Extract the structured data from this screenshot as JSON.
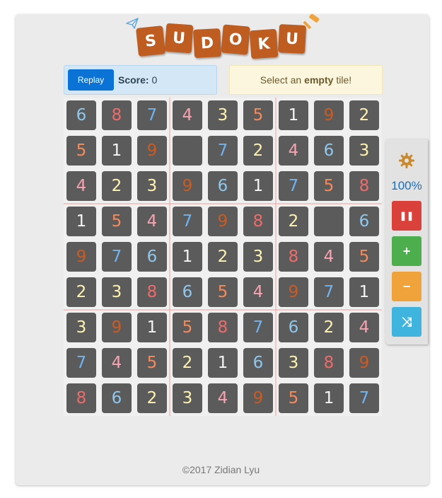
{
  "logo": {
    "letters": [
      "S",
      "U",
      "D",
      "O",
      "K",
      "U"
    ],
    "tile_color": "#bf5c20",
    "icons": [
      "paper-plane-icon",
      "hammer-icon"
    ]
  },
  "score_panel": {
    "replay_label": "Replay",
    "score_label": "Score:",
    "score_value": "0"
  },
  "message": {
    "prefix": "Select an",
    "emphasis": "empty",
    "suffix": "tile!"
  },
  "board": {
    "rows": [
      [
        "6",
        "8",
        "7",
        "4",
        "3",
        "5",
        "1",
        "9",
        "2"
      ],
      [
        "5",
        "1",
        "9",
        "",
        "7",
        "2",
        "4",
        "6",
        "3"
      ],
      [
        "4",
        "2",
        "3",
        "9",
        "6",
        "1",
        "7",
        "5",
        "8"
      ],
      [
        "1",
        "5",
        "4",
        "7",
        "9",
        "8",
        "2",
        "",
        "6"
      ],
      [
        "9",
        "7",
        "6",
        "1",
        "2",
        "3",
        "8",
        "4",
        "5"
      ],
      [
        "2",
        "3",
        "8",
        "6",
        "5",
        "4",
        "9",
        "7",
        "1"
      ],
      [
        "3",
        "9",
        "1",
        "5",
        "8",
        "7",
        "6",
        "2",
        "4"
      ],
      [
        "7",
        "4",
        "5",
        "2",
        "1",
        "6",
        "3",
        "8",
        "9"
      ],
      [
        "8",
        "6",
        "2",
        "3",
        "4",
        "9",
        "5",
        "1",
        "7"
      ]
    ],
    "digit_colors": {
      "1": "#f5f5f5",
      "2": "#fff3b0",
      "3": "#fff3b0",
      "4": "#f7a3b0",
      "5": "#f78a5a",
      "6": "#8fc8ec",
      "7": "#6fb3f0",
      "8": "#f06a6a",
      "9": "#cf5a20"
    }
  },
  "side_panel": {
    "settings_icon": "gear-icon",
    "zoom": "100%",
    "buttons": [
      {
        "name": "pause-button",
        "symbol": "❚❚",
        "color": "#d9413a"
      },
      {
        "name": "zoom-in-button",
        "symbol": "+",
        "color": "#4cae4c"
      },
      {
        "name": "zoom-out-button",
        "symbol": "−",
        "color": "#f0a33a"
      },
      {
        "name": "shuffle-button",
        "symbol": "⤨",
        "color": "#3fb4df"
      }
    ]
  },
  "footer": {
    "text": "©2017 Zidian Lyu"
  }
}
